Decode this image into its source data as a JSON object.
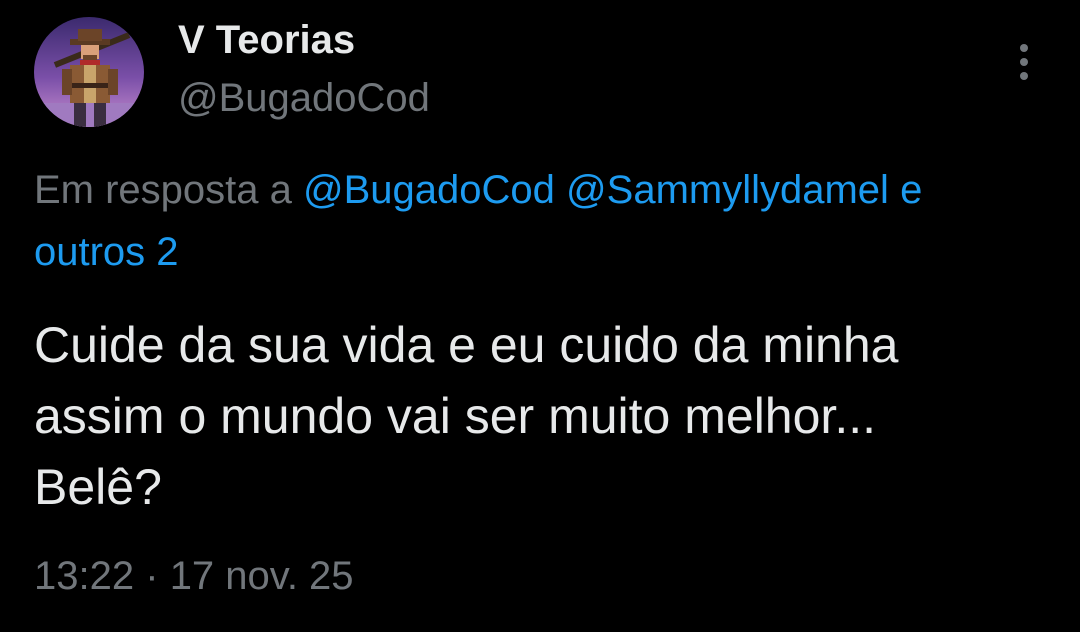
{
  "author": {
    "display_name": "V Teorias",
    "handle": "@BugadoCod"
  },
  "reply_context": {
    "prefix": "Em resposta a",
    "mentions": [
      "@BugadoCod",
      "@Sammyllydamel",
      "e"
    ],
    "others": "outros 2"
  },
  "tweet": {
    "lines": [
      "Cuide da sua vida e eu cuido da minha",
      "assim o mundo vai ser muito melhor...",
      "Belê?"
    ]
  },
  "meta": {
    "time": "13:22",
    "separator": "·",
    "date": "17 nov. 25"
  },
  "colors": {
    "background": "#000000",
    "text_primary": "#e7e9ea",
    "text_secondary": "#71767b",
    "link": "#1d9bf0"
  },
  "icons": {
    "more": "three-dots-vertical-icon",
    "avatar": "pixel-art-cowboy-avatar"
  }
}
